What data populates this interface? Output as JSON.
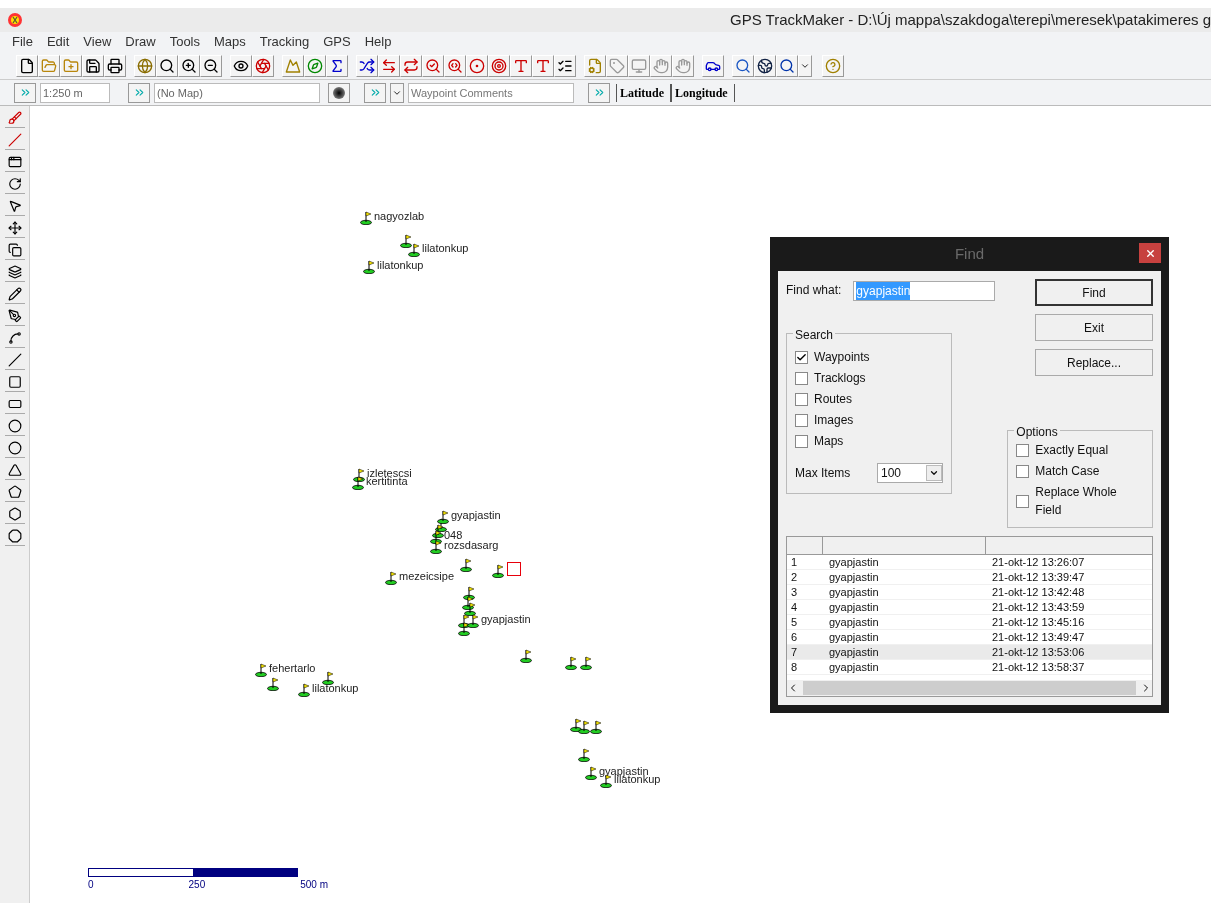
{
  "window": {
    "title": "GPS TrackMaker - D:\\Új mappa\\szakdoga\\terepi\\meresek\\patakimeres g"
  },
  "menu": [
    "File",
    "Edit",
    "View",
    "Draw",
    "Tools",
    "Maps",
    "Tracking",
    "GPS",
    "Help"
  ],
  "scale_field": {
    "value": "1:250 m"
  },
  "map_field": {
    "value": "(No Map)"
  },
  "comments_field": {
    "placeholder": "Waypoint Comments"
  },
  "coordinates": [
    "Latitude",
    "Longitude"
  ],
  "waypoints": [
    {
      "label": "nagyozlab"
    },
    {
      "label": "lilatonkup"
    },
    {
      "label": "lilatonkup"
    },
    {
      "label": "izletescsi"
    },
    {
      "label": "kertitinta"
    },
    {
      "label": "gyapjastin"
    },
    {
      "label": "048"
    },
    {
      "label": "rozsdasarg"
    },
    {
      "label": "mezeicsipe"
    },
    {
      "label": "gyapjastin"
    },
    {
      "label": "fehertarlo"
    },
    {
      "label": "lilatonkup"
    },
    {
      "label": "gyapjastin"
    },
    {
      "label": "lilatonkup"
    }
  ],
  "scale_bar": {
    "labels": [
      "0",
      "250",
      "500 m"
    ]
  },
  "find_dialog": {
    "title": "Find",
    "find_what_label": "Find what:",
    "find_what": "gyapjastin",
    "buttons": [
      "Find",
      "Exit",
      "Replace..."
    ],
    "search_group": "Search",
    "search_options": [
      {
        "label": "Waypoints",
        "checked": true
      },
      {
        "label": "Tracklogs",
        "checked": false
      },
      {
        "label": "Routes",
        "checked": false
      },
      {
        "label": "Images",
        "checked": false
      },
      {
        "label": "Maps",
        "checked": false
      }
    ],
    "max_items_label": "Max Items",
    "max_items": "100",
    "options_group": "Options",
    "options": [
      {
        "label": "Exactly Equal",
        "checked": false
      },
      {
        "label": "Match Case",
        "checked": false
      },
      {
        "label": "Replace Whole Field",
        "checked": false
      }
    ],
    "results": [
      {
        "index": "1",
        "name": "gyapjastin",
        "time": "21-okt-12 13:26:07",
        "selected": false
      },
      {
        "index": "2",
        "name": "gyapjastin",
        "time": "21-okt-12 13:39:47",
        "selected": false
      },
      {
        "index": "3",
        "name": "gyapjastin",
        "time": "21-okt-12 13:42:48",
        "selected": false
      },
      {
        "index": "4",
        "name": "gyapjastin",
        "time": "21-okt-12 13:43:59",
        "selected": false
      },
      {
        "index": "5",
        "name": "gyapjastin",
        "time": "21-okt-12 13:45:16",
        "selected": false
      },
      {
        "index": "6",
        "name": "gyapjastin",
        "time": "21-okt-12 13:49:47",
        "selected": false
      },
      {
        "index": "7",
        "name": "gyapjastin",
        "time": "21-okt-12 13:53:06",
        "selected": true
      },
      {
        "index": "8",
        "name": "gyapjastin",
        "time": "21-okt-12 13:58:37",
        "selected": false
      }
    ]
  }
}
